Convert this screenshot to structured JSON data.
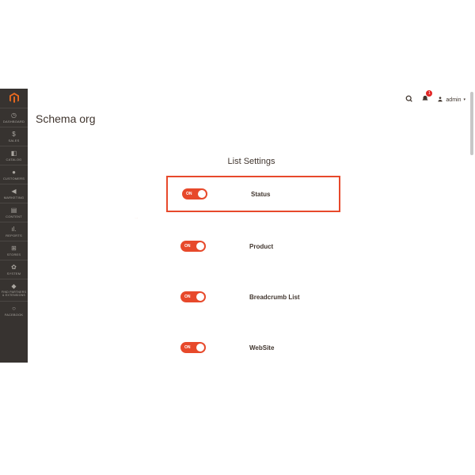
{
  "colors": {
    "accent": "#e7492b",
    "sidebar": "#373330",
    "danger": "#e22626"
  },
  "sidebar": {
    "items": [
      {
        "label": "DASHBOARD",
        "icon": "◷"
      },
      {
        "label": "SALES",
        "icon": "$"
      },
      {
        "label": "CATALOG",
        "icon": "◧"
      },
      {
        "label": "CUSTOMERS",
        "icon": "●"
      },
      {
        "label": "MARKETING",
        "icon": "◀"
      },
      {
        "label": "CONTENT",
        "icon": "▤"
      },
      {
        "label": "REPORTS",
        "icon": "ıl."
      },
      {
        "label": "STORES",
        "icon": "⊞"
      },
      {
        "label": "SYSTEM",
        "icon": "✿"
      },
      {
        "label": "FIND PARTNERS & EXTENSIONS",
        "icon": "◆"
      },
      {
        "label": "FACEBOOK",
        "icon": "○"
      }
    ]
  },
  "header": {
    "notifications": "1",
    "user_label": "admin"
  },
  "page": {
    "title": "Schema org",
    "section_title": "List Settings"
  },
  "settings": [
    {
      "label": "Status",
      "state": "ON",
      "highlight": true
    },
    {
      "label": "Product",
      "state": "ON",
      "highlight": false
    },
    {
      "label": "Breadcrumb List",
      "state": "ON",
      "highlight": false
    },
    {
      "label": "WebSite",
      "state": "ON",
      "highlight": false
    }
  ]
}
